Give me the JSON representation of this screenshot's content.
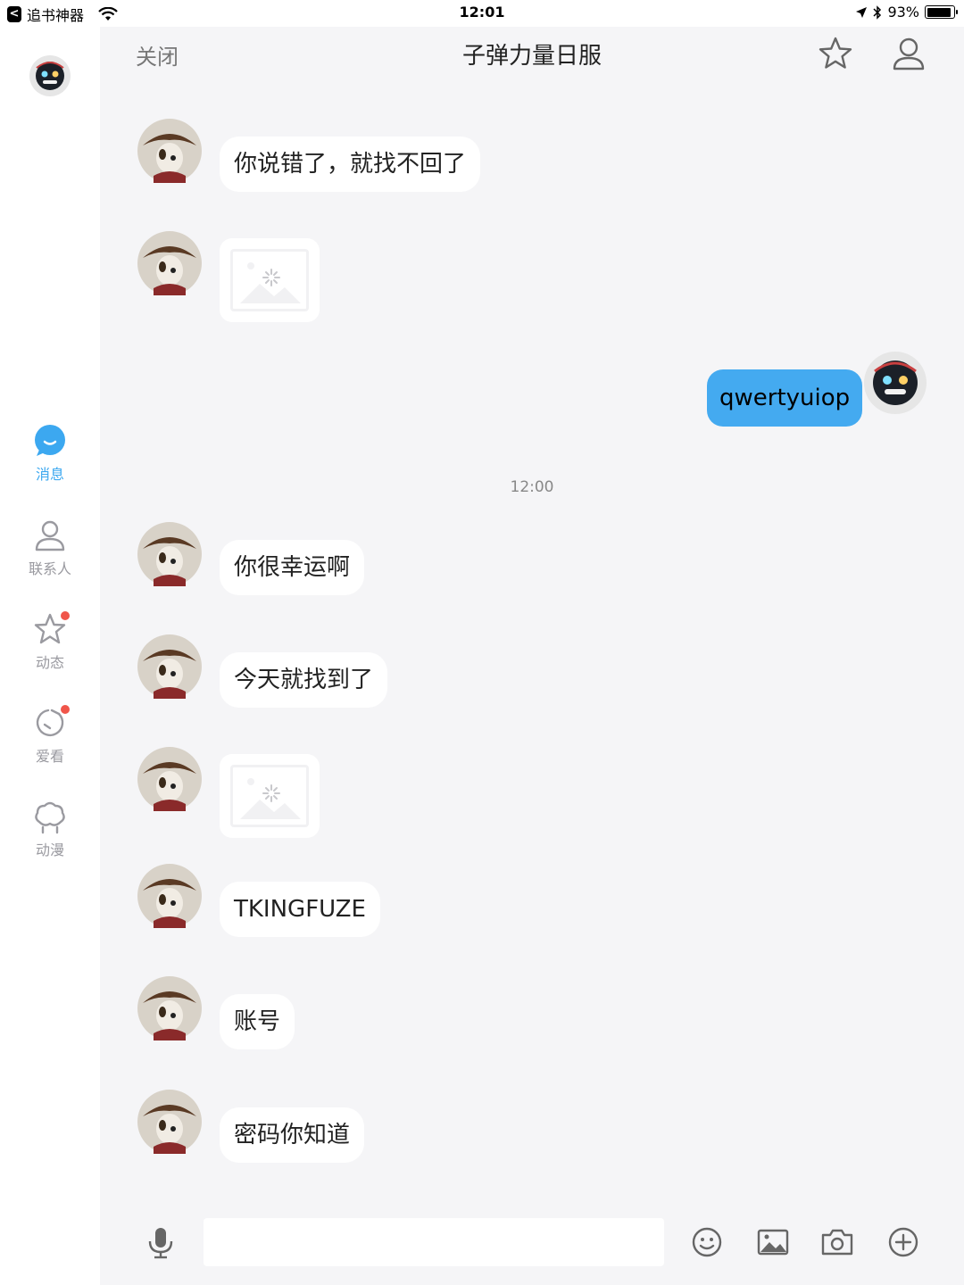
{
  "status_bar": {
    "back_app": "追书神器",
    "time": "12:01",
    "battery_percent": "93%",
    "battery_level": 0.93
  },
  "rail": {
    "items": [
      {
        "label": "消息",
        "icon": "message-icon",
        "active": true
      },
      {
        "label": "联系人",
        "icon": "contacts-icon"
      },
      {
        "label": "动态",
        "icon": "star-icon",
        "badge": true
      },
      {
        "label": "爱看",
        "icon": "watch-icon",
        "badge": true
      },
      {
        "label": "动漫",
        "icon": "cartoon-icon"
      }
    ]
  },
  "header": {
    "close_label": "关闭",
    "title": "子弹力量日服"
  },
  "messages": [
    {
      "type": "text",
      "text": "你说错了，就找不回了"
    },
    {
      "type": "image"
    },
    {
      "type": "mine_text",
      "text": "qwertyuiop"
    },
    {
      "type": "timestamp",
      "text": "12:00"
    },
    {
      "type": "text",
      "text": "你很幸运啊"
    },
    {
      "type": "text",
      "text": "今天就找到了"
    },
    {
      "type": "image"
    },
    {
      "type": "text",
      "text": "TKINGFUZE"
    },
    {
      "type": "text",
      "text": "账号"
    },
    {
      "type": "text",
      "text": "密码你知道"
    }
  ],
  "input": {
    "placeholder": "",
    "value": ""
  },
  "colors": {
    "accent": "#3ca8f0",
    "mine_bubble": "#44aaf0",
    "badge": "#f0554a"
  }
}
